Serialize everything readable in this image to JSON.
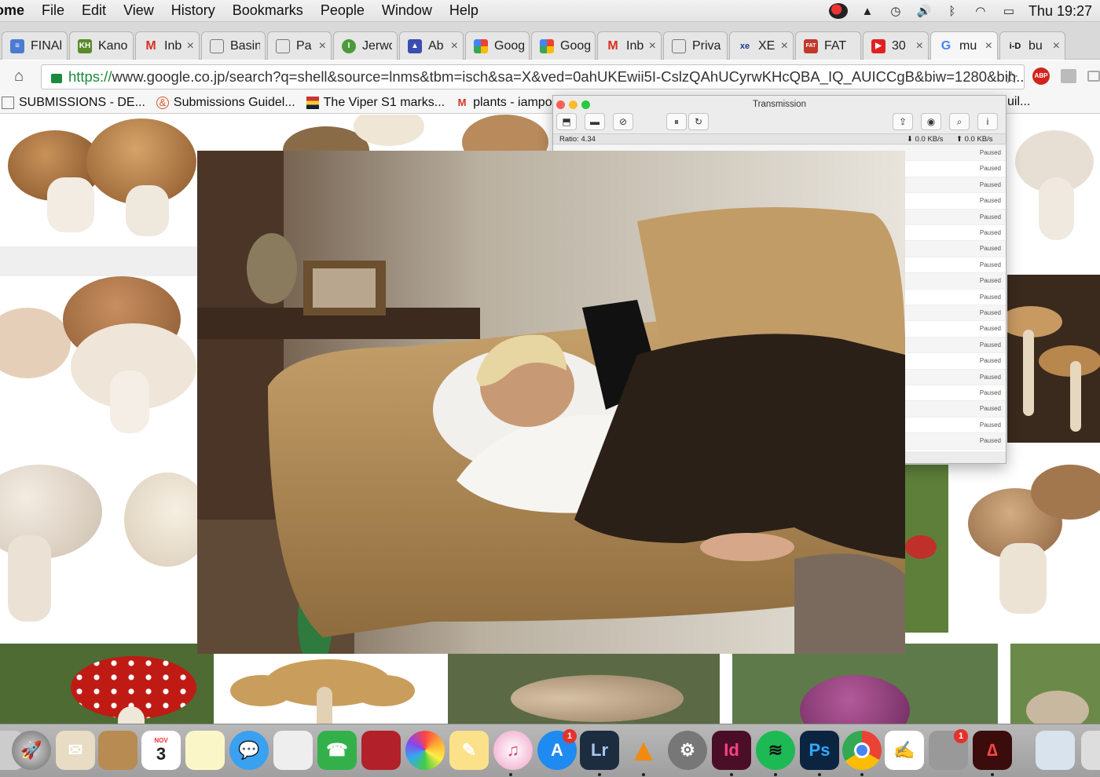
{
  "menubar": {
    "app": "ome",
    "items": [
      "File",
      "Edit",
      "View",
      "History",
      "Bookmarks",
      "People",
      "Window",
      "Help"
    ],
    "clock": "Thu 19:27"
  },
  "tabs": [
    {
      "label": "FINAl",
      "icon": "doc-icon",
      "color": "#4a7bd0",
      "close": ""
    },
    {
      "label": "Kano",
      "icon": "kh-icon",
      "color": "#5a8a2a",
      "close": ""
    },
    {
      "label": "Inb",
      "icon": "gmail-icon",
      "color": "#d93025",
      "close": "×"
    },
    {
      "label": "Basin",
      "icon": "page-icon",
      "color": "#ffffff",
      "close": ""
    },
    {
      "label": "Pa",
      "icon": "page-icon",
      "color": "#ffffff",
      "close": "×"
    },
    {
      "label": "Jerwo",
      "icon": "jerwood-icon",
      "color": "#4c9a3a",
      "close": ""
    },
    {
      "label": "Ab",
      "icon": "triangle-icon",
      "color": "#3a4db0",
      "close": "×"
    },
    {
      "label": "Goog",
      "icon": "google-photos-icon",
      "color": "#e8a21b",
      "close": ""
    },
    {
      "label": "Goog",
      "icon": "google-photos-icon",
      "color": "#e8a21b",
      "close": ""
    },
    {
      "label": "Inb",
      "icon": "gmail-icon",
      "color": "#d93025",
      "close": "×"
    },
    {
      "label": "Priva",
      "icon": "page-icon",
      "color": "#ffffff",
      "close": ""
    },
    {
      "label": "XE",
      "icon": "xe-icon",
      "color": "#ffffff",
      "close": "×"
    },
    {
      "label": "FAT",
      "icon": "fat-icon",
      "color": "#c0392b",
      "close": ""
    },
    {
      "label": "30",
      "icon": "youtube-icon",
      "color": "#e02020",
      "close": "×"
    },
    {
      "label": "mu",
      "icon": "google-icon",
      "color": "#ffffff",
      "close": "×"
    },
    {
      "label": "bu",
      "icon": "id-icon",
      "color": "#ffffff",
      "close": "×"
    }
  ],
  "omnibox": {
    "scheme": "https://",
    "url": "www.google.co.jp/search?q=shell&source=lnms&tbm=isch&sa=X&ved=0ahUKEwii5I-CslzQAhUCyrwKHcQBA_IQ_AUICCgB&biw=1280&bih..."
  },
  "extensions": {
    "abp": "ABP"
  },
  "bookmarks": [
    {
      "label": "SUBMISSIONS - DE...",
      "icon": "page-icon"
    },
    {
      "label": "Submissions Guidel...",
      "icon": "ampersand-icon"
    },
    {
      "label": "The Viper S1 marks...",
      "icon": "flag-icon"
    },
    {
      "label": "plants - iampoll",
      "icon": "gmail-icon"
    }
  ],
  "bookmarks_overflow": "uil...",
  "transmission": {
    "title": "Transmission",
    "ratio": "Ratio: 4.34",
    "down": "⬇ 0.0 KB/s",
    "up": "⬆ 0.0 KB/s",
    "rows": [
      "Paused",
      "Paused",
      "Paused",
      "Paused",
      "Paused",
      "Paused",
      "Paused",
      "Paused",
      "Paused",
      "Paused",
      "Paused",
      "Paused",
      "Paused",
      "Paused",
      "Paused",
      "Paused",
      "Paused",
      "Paused",
      "Paused"
    ]
  },
  "dock": {
    "calendar_month": "NOV",
    "calendar_day": "3",
    "appstore_badge": "1",
    "other_badge": "1",
    "lr": "Lr",
    "id": "Id",
    "ps": "Ps"
  }
}
